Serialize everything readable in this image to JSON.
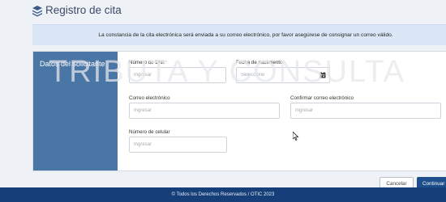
{
  "header": {
    "title": "Registro de cita",
    "icon": "layers-icon"
  },
  "notice": {
    "text": "La constancia de la cita electrónica será enviada a su correo electrónico, por favor asegúrese de consignar un correo válido."
  },
  "form": {
    "section_title": "Datos del solicitante",
    "fields": {
      "dni": {
        "label": "Número de DNI:",
        "placeholder": "Ingresar",
        "value": ""
      },
      "birth_date": {
        "label": "Fecha de nacimiento:",
        "placeholder": "Seleccione",
        "value": "",
        "icon": "calendar-icon"
      },
      "email": {
        "label": "Correo electrónico",
        "placeholder": "Ingresar",
        "value": ""
      },
      "email_confirm": {
        "label": "Confirmar correo electrónico",
        "placeholder": "Ingresar",
        "value": ""
      },
      "phone": {
        "label": "Número de celular",
        "placeholder": "Ingresar",
        "value": ""
      }
    }
  },
  "watermark": "TRIBUTA Y CONSULTA",
  "actions": {
    "cancel_label": "Cancelar",
    "continue_label": "Continuar"
  },
  "footer": {
    "text": "© Todos los Derechos Reservados / OTIC 2023"
  },
  "colors": {
    "sidebar": "#4a76a6",
    "primary_button": "#1f4e8c",
    "footer": "#163f7a",
    "notice_bg": "#dbe7f6"
  }
}
